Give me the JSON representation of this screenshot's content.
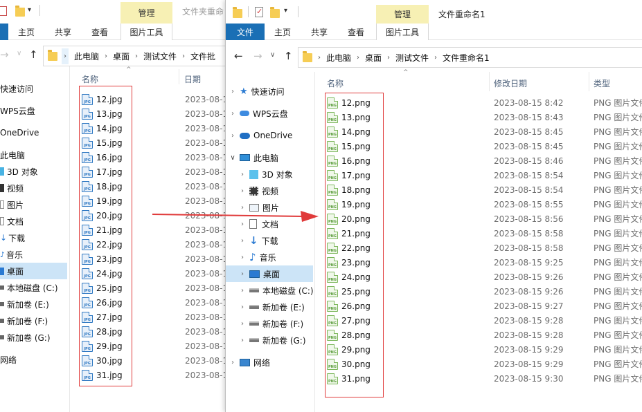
{
  "back_window": {
    "title": "文件夹重命",
    "manage_tab": "管理",
    "ribbon": {
      "home": "主页",
      "share": "共享",
      "view": "查看",
      "pic_tools": "图片工具"
    },
    "breadcrumb": [
      "此电脑",
      "桌面",
      "测试文件",
      "文件批"
    ],
    "nav": [
      {
        "label": "快速访问"
      },
      {
        "label": "WPS云盘"
      },
      {
        "label": "OneDrive"
      },
      {
        "label": "此电脑"
      },
      {
        "label": "3D 对象"
      },
      {
        "label": "视频"
      },
      {
        "label": "图片"
      },
      {
        "label": "文档"
      },
      {
        "label": "下载"
      },
      {
        "label": "音乐"
      },
      {
        "label": "桌面"
      },
      {
        "label": "本地磁盘 (C:)"
      },
      {
        "label": "新加卷 (E:)"
      },
      {
        "label": "新加卷 (F:)"
      },
      {
        "label": "新加卷 (G:)"
      },
      {
        "label": "网络"
      }
    ],
    "columns": {
      "name": "名称",
      "date": "日期"
    },
    "files": [
      {
        "name": "12.jpg",
        "date": "2023-08-1"
      },
      {
        "name": "13.jpg",
        "date": "2023-08-1"
      },
      {
        "name": "14.jpg",
        "date": "2023-08-1"
      },
      {
        "name": "15.jpg",
        "date": "2023-08-1"
      },
      {
        "name": "16.jpg",
        "date": "2023-08-1"
      },
      {
        "name": "17.jpg",
        "date": "2023-08-1"
      },
      {
        "name": "18.jpg",
        "date": "2023-08-1"
      },
      {
        "name": "19.jpg",
        "date": "2023-08-1"
      },
      {
        "name": "20.jpg",
        "date": "2023-08-1"
      },
      {
        "name": "21.jpg",
        "date": "2023-08-1"
      },
      {
        "name": "22.jpg",
        "date": "2023-08-1"
      },
      {
        "name": "23.jpg",
        "date": "2023-08-1"
      },
      {
        "name": "24.jpg",
        "date": "2023-08-1"
      },
      {
        "name": "25.jpg",
        "date": "2023-08-1"
      },
      {
        "name": "26.jpg",
        "date": "2023-08-1"
      },
      {
        "name": "27.jpg",
        "date": "2023-08-1"
      },
      {
        "name": "28.jpg",
        "date": "2023-08-1"
      },
      {
        "name": "29.jpg",
        "date": "2023-08-1"
      },
      {
        "name": "30.jpg",
        "date": "2023-08-1"
      },
      {
        "name": "31.jpg",
        "date": "2023-08-1"
      }
    ]
  },
  "front_window": {
    "title": "文件重命名1",
    "manage_tab": "管理",
    "ribbon": {
      "file": "文件",
      "home": "主页",
      "share": "共享",
      "view": "查看",
      "pic_tools": "图片工具"
    },
    "breadcrumb": [
      "此电脑",
      "桌面",
      "测试文件",
      "文件重命名1"
    ],
    "nav": [
      {
        "label": "快速访问",
        "icon": "star-icon"
      },
      {
        "label": "WPS云盘",
        "icon": "cloud-icon"
      },
      {
        "label": "OneDrive",
        "icon": "onedrive-icon"
      },
      {
        "label": "此电脑",
        "icon": "computer-icon"
      },
      {
        "label": "3D 对象",
        "icon": "cube-icon"
      },
      {
        "label": "视频",
        "icon": "video-icon"
      },
      {
        "label": "图片",
        "icon": "picture-icon"
      },
      {
        "label": "文档",
        "icon": "document-icon"
      },
      {
        "label": "下载",
        "icon": "download-icon"
      },
      {
        "label": "音乐",
        "icon": "music-icon"
      },
      {
        "label": "桌面",
        "icon": "desktop-icon"
      },
      {
        "label": "本地磁盘 (C:)",
        "icon": "drive-icon"
      },
      {
        "label": "新加卷 (E:)",
        "icon": "drive-icon"
      },
      {
        "label": "新加卷 (F:)",
        "icon": "drive-icon"
      },
      {
        "label": "新加卷 (G:)",
        "icon": "drive-icon"
      },
      {
        "label": "网络",
        "icon": "network-icon"
      }
    ],
    "columns": {
      "name": "名称",
      "date": "修改日期",
      "type": "类型"
    },
    "files": [
      {
        "name": "12.png",
        "date": "2023-08-15 8:42",
        "type": "PNG 图片文件"
      },
      {
        "name": "13.png",
        "date": "2023-08-15 8:43",
        "type": "PNG 图片文件"
      },
      {
        "name": "14.png",
        "date": "2023-08-15 8:45",
        "type": "PNG 图片文件"
      },
      {
        "name": "15.png",
        "date": "2023-08-15 8:45",
        "type": "PNG 图片文件"
      },
      {
        "name": "16.png",
        "date": "2023-08-15 8:46",
        "type": "PNG 图片文件"
      },
      {
        "name": "17.png",
        "date": "2023-08-15 8:54",
        "type": "PNG 图片文件"
      },
      {
        "name": "18.png",
        "date": "2023-08-15 8:54",
        "type": "PNG 图片文件"
      },
      {
        "name": "19.png",
        "date": "2023-08-15 8:55",
        "type": "PNG 图片文件"
      },
      {
        "name": "20.png",
        "date": "2023-08-15 8:56",
        "type": "PNG 图片文件"
      },
      {
        "name": "21.png",
        "date": "2023-08-15 8:58",
        "type": "PNG 图片文件"
      },
      {
        "name": "22.png",
        "date": "2023-08-15 8:58",
        "type": "PNG 图片文件"
      },
      {
        "name": "23.png",
        "date": "2023-08-15 9:25",
        "type": "PNG 图片文件"
      },
      {
        "name": "24.png",
        "date": "2023-08-15 9:26",
        "type": "PNG 图片文件"
      },
      {
        "name": "25.png",
        "date": "2023-08-15 9:26",
        "type": "PNG 图片文件"
      },
      {
        "name": "26.png",
        "date": "2023-08-15 9:27",
        "type": "PNG 图片文件"
      },
      {
        "name": "27.png",
        "date": "2023-08-15 9:28",
        "type": "PNG 图片文件"
      },
      {
        "name": "28.png",
        "date": "2023-08-15 9:28",
        "type": "PNG 图片文件"
      },
      {
        "name": "29.png",
        "date": "2023-08-15 9:29",
        "type": "PNG 图片文件"
      },
      {
        "name": "30.png",
        "date": "2023-08-15 9:29",
        "type": "PNG 图片文件"
      },
      {
        "name": "31.png",
        "date": "2023-08-15 9:30",
        "type": "PNG 图片文件"
      }
    ]
  },
  "annotation": {
    "arrow_color": "#e03a3a",
    "box_color": "#e03a3a"
  }
}
